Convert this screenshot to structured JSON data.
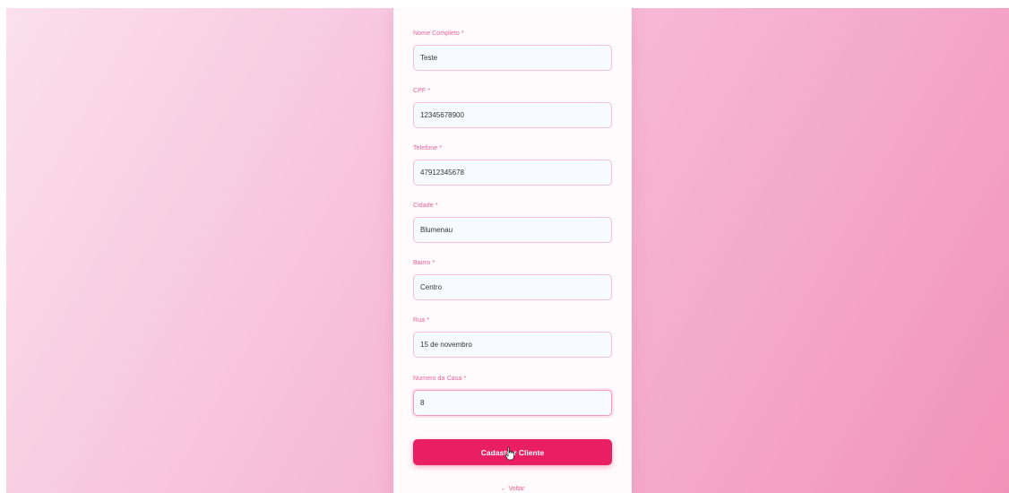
{
  "form": {
    "fields": [
      {
        "label": "Nome Completo *",
        "value": "Teste"
      },
      {
        "label": "CPF *",
        "value": "12345678900"
      },
      {
        "label": "Telefone *",
        "value": "47912345678"
      },
      {
        "label": "Cidade *",
        "value": "Blumenau"
      },
      {
        "label": "Bairro *",
        "value": "Centro"
      },
      {
        "label": "Rua *",
        "value": "15 de novembro"
      },
      {
        "label": "Numero da Casa *",
        "value": "8"
      }
    ],
    "submit_label": "Cadastrar Cliente",
    "back_label": "← Voltar"
  },
  "colors": {
    "accent": "#e91e63",
    "label": "#ec5f97",
    "input_border": "#f6bfd6"
  },
  "icons": {
    "cursor": "hand-pointer-icon"
  }
}
